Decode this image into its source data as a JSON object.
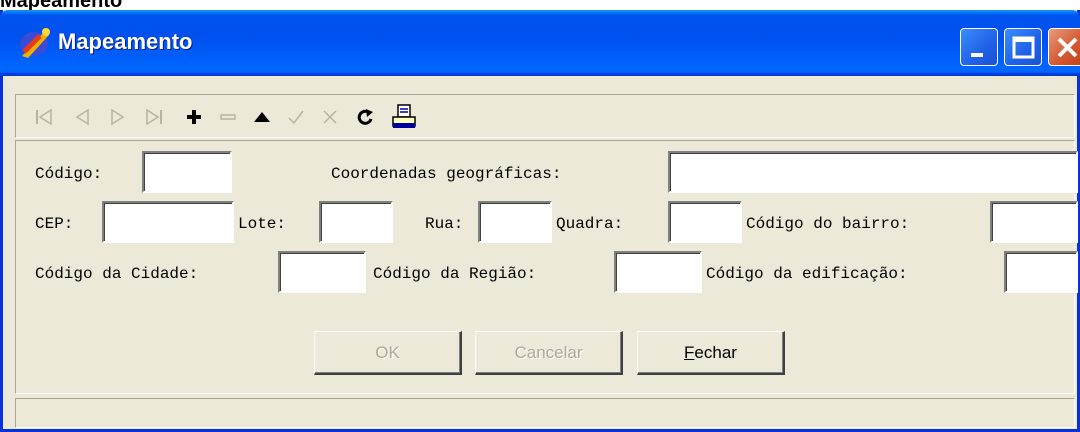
{
  "caption": "Mapeamento",
  "window": {
    "title": "Mapeamento"
  },
  "form": {
    "codigo_label": "Código:",
    "coordenadas_label": "Coordenadas geográficas:",
    "cep_label": "CEP:",
    "lote_label": "Lote:",
    "rua_label": "Rua:",
    "quadra_label": "Quadra:",
    "codigo_bairro_label": "Código do bairro:",
    "codigo_cidade_label": "Código da Cidade:",
    "codigo_regiao_label": "Código da Região:",
    "codigo_edificacao_label": "Código da edificação:"
  },
  "buttons": {
    "ok": "OK",
    "cancelar": "Cancelar",
    "fechar_prefix": "F",
    "fechar_rest": "echar"
  },
  "colors": {
    "titlebar": "#0053ee",
    "frame": "#0831d9",
    "face": "#ece9d8"
  },
  "icons": [
    "first-record-icon",
    "prior-record-icon",
    "next-record-icon",
    "last-record-icon",
    "insert-icon",
    "delete-icon",
    "edit-icon",
    "post-icon",
    "cancel-edit-icon",
    "refresh-icon",
    "print-icon"
  ]
}
